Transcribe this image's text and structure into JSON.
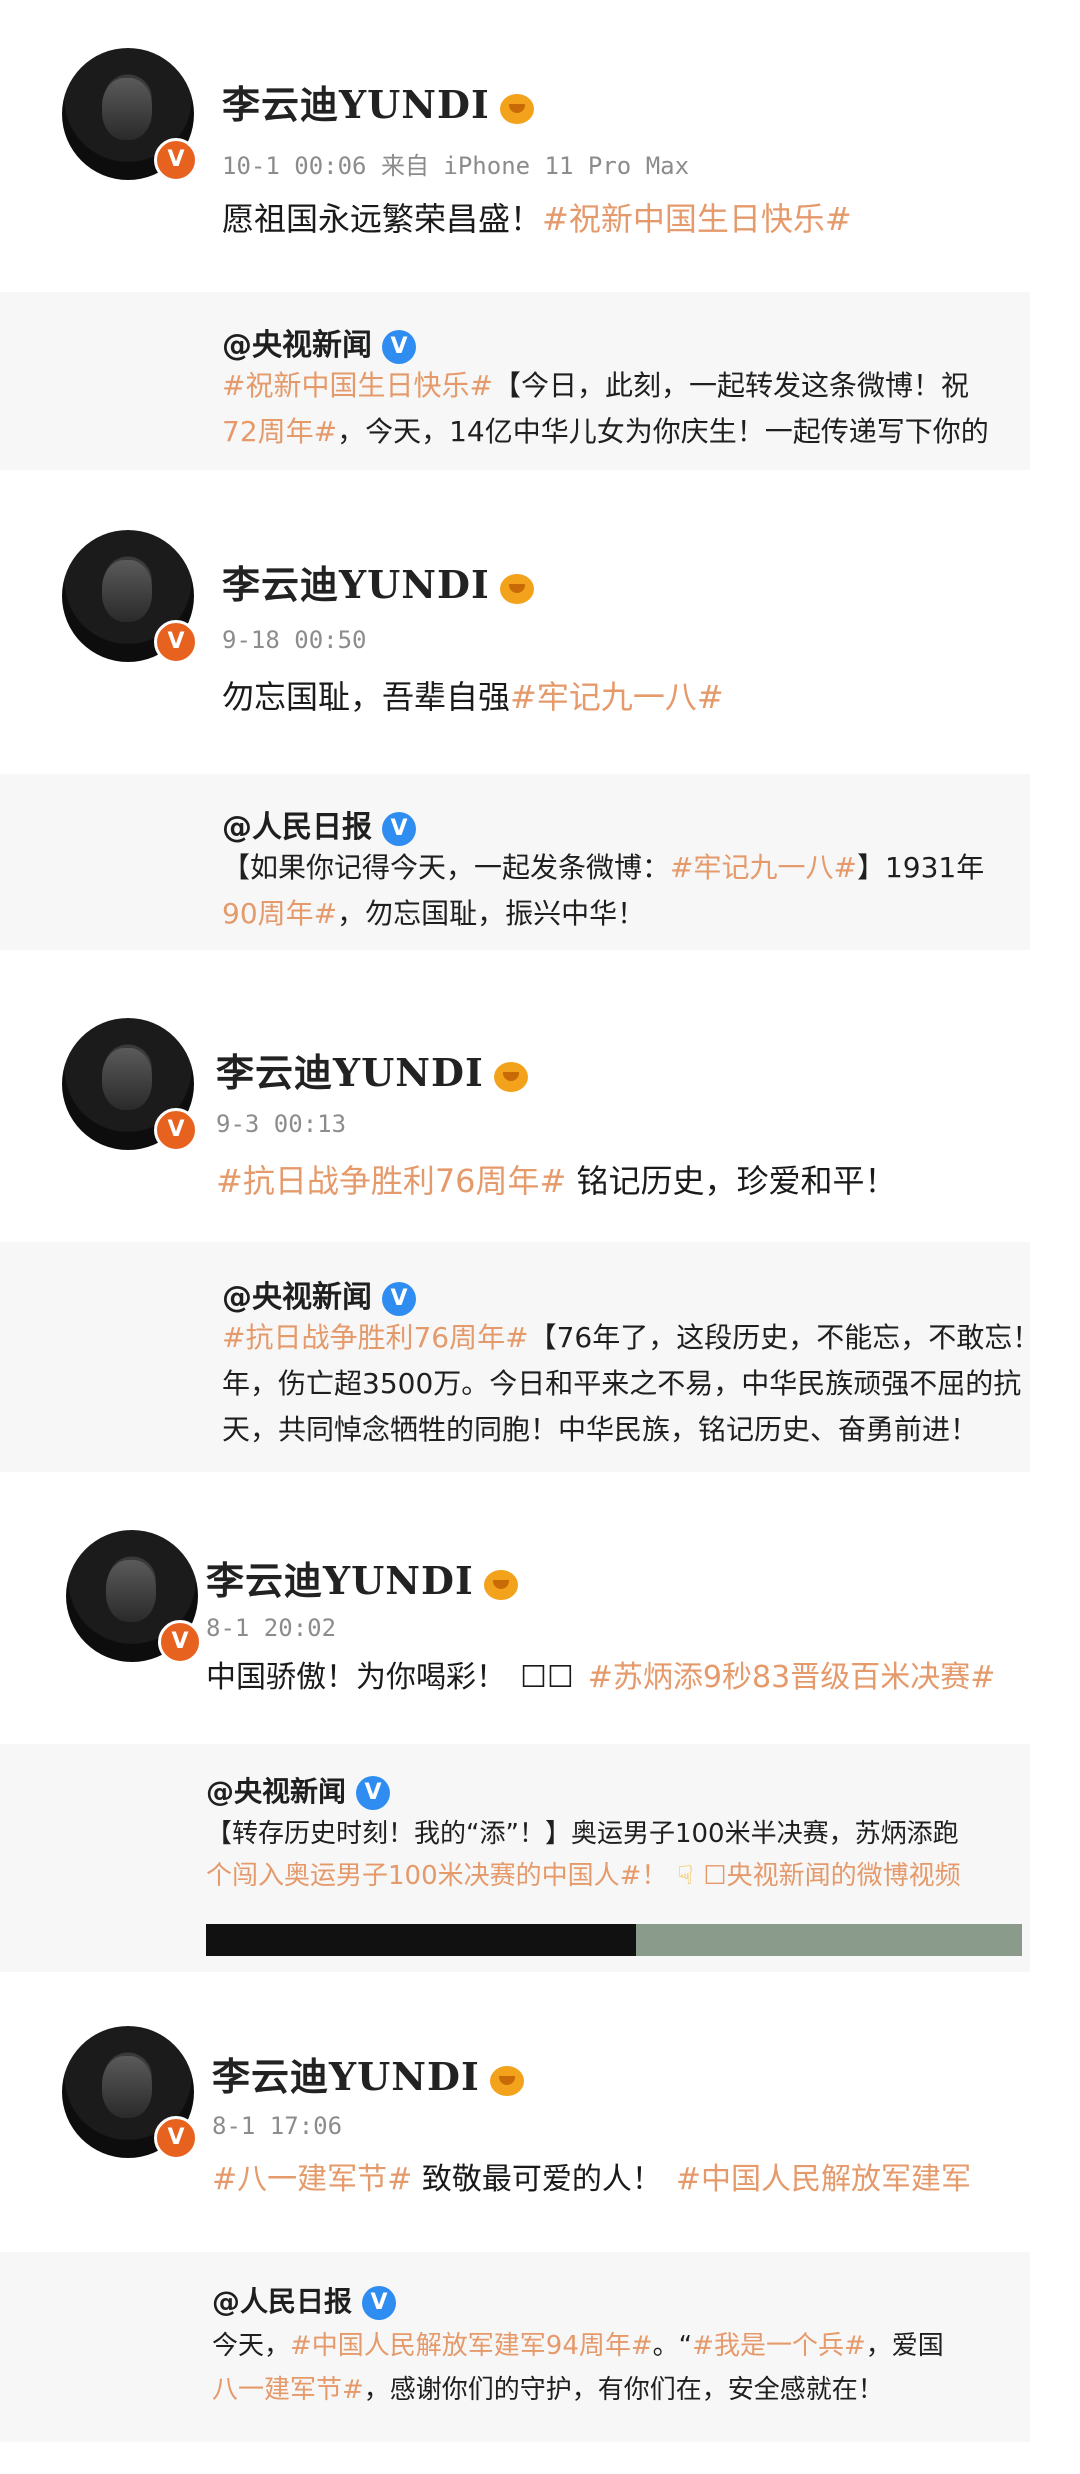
{
  "posts": [
    {
      "author": "李云迪YUNDI",
      "time": "10-1 00:06",
      "source": "来自 iPhone 11 Pro Max",
      "text_plain": "愿祖国永远繁荣昌盛！",
      "text_tag": "#祝新中国生日快乐#",
      "repost": {
        "source_name": "@央视新闻",
        "line1_tag": "#祝新中国生日快乐#",
        "line1_text": "【今日，此刻，一起转发这条微博！祝",
        "line2_tag": "72周年#",
        "line2_text": "，今天，14亿中华儿女为你庆生！一起传递写下你的"
      }
    },
    {
      "author": "李云迪YUNDI",
      "time": "9-18 00:50",
      "text_plain": "勿忘国耻，吾辈自强",
      "text_tag": "#牢记九一八#",
      "repost": {
        "source_name": "@人民日报",
        "line1_text_a": "【如果你记得今天，一起发条微博：",
        "line1_tag": "#牢记九一八#",
        "line1_text_b": "】1931年",
        "line2_tag": "90周年#",
        "line2_text": "，勿忘国耻，振兴中华！"
      }
    },
    {
      "author": "李云迪YUNDI",
      "time": "9-3 00:13",
      "text_tag": "#抗日战争胜利76周年#",
      "text_plain": " 铭记历史，珍爱和平！",
      "repost": {
        "source_name": "@央视新闻",
        "line1_tag": "#抗日战争胜利76周年#",
        "line1_text": "【76年了，这段历史，不能忘，不敢忘！",
        "line2_text": "年，伤亡超3500万。今日和平来之不易，中华民族顽强不屈的抗",
        "line3_text": "天，共同悼念牺牲的同胞！中华民族，铭记历史、奋勇前进！"
      }
    },
    {
      "author": "李云迪YUNDI",
      "time": "8-1 20:02",
      "text_plain": "中国骄傲！为你喝彩！",
      "text_emoji": "☐☐",
      "text_tag": "#苏炳添9秒83晋级百米决赛#",
      "repost": {
        "source_name": "@央视新闻",
        "line1_text": "【转存历史时刻！我的“添”！】奥运男子100米半决赛，苏炳添跑",
        "line2_tag": "个闯入奥运男子100米决赛的中国人#！",
        "line2_link": "☐央视新闻的微博视频"
      }
    },
    {
      "author": "李云迪YUNDI",
      "time": "8-1 17:06",
      "text_tag": "#八一建军节#",
      "text_plain": " 致敬最可爱的人！",
      "text_tag2": "#中国人民解放军建军",
      "repost": {
        "source_name": "@人民日报",
        "line1_text_a": "今天，",
        "line1_tag": "#中国人民解放军建军94周年#",
        "line1_text_b": "。“",
        "line1_tag2": "#我是一个兵#",
        "line1_text_c": "，爱国",
        "line2_tag": "八一建军节#",
        "line2_text": "，感谢你们的守护，有你们在，安全感就在！"
      }
    }
  ],
  "colors": {
    "tag": "#e59a6b",
    "verified_orange": "#e8621f",
    "verified_blue": "#2f8cf0",
    "repost_bg": "#f7f7f7"
  }
}
